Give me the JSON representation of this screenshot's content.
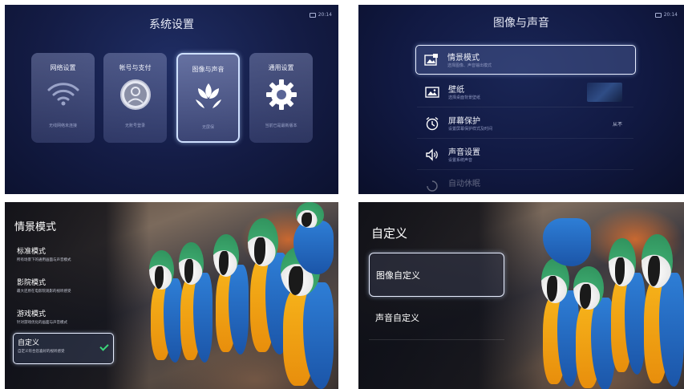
{
  "panel1": {
    "title": "系统设置",
    "clock": "20:14",
    "cards": [
      {
        "label": "网络设置",
        "sub": "无线网络未连接",
        "icon": "wifi-icon"
      },
      {
        "label": "帐号与支付",
        "sub": "无账号登录",
        "icon": "user-icon"
      },
      {
        "label": "图像与声音",
        "sub": "无屏保",
        "icon": "flower-icon"
      },
      {
        "label": "通用设置",
        "sub": "当前已是最新版本",
        "icon": "gear-icon"
      }
    ]
  },
  "panel2": {
    "title": "图像与声音",
    "clock": "20:14",
    "rows": [
      {
        "title": "情景模式",
        "sub": "选择图像、声音输出模式",
        "value": "",
        "icon": "scene-mode-icon"
      },
      {
        "title": "壁纸",
        "sub": "选择桌面背景壁纸",
        "value": "",
        "icon": "wallpaper-icon"
      },
      {
        "title": "屏幕保护",
        "sub": "设置屏幕保护样式及时间",
        "value": "从不",
        "icon": "alarm-clock-icon"
      },
      {
        "title": "声音设置",
        "sub": "设置系统声音",
        "value": "",
        "icon": "speaker-icon"
      },
      {
        "title": "自动休眠",
        "sub": "",
        "value": "",
        "icon": "sleep-icon"
      }
    ]
  },
  "panel3": {
    "heading": "情景模式",
    "modes": [
      {
        "title": "标准模式",
        "sub": "所有场景下的通用画面与声音模式"
      },
      {
        "title": "影院模式",
        "sub": "最大还原在电影院观影的视听感受"
      },
      {
        "title": "游戏模式",
        "sub": "针对游戏优化的画面与声音模式"
      },
      {
        "title": "自定义",
        "sub": "自定义符合您喜好的视听感受",
        "selected": true
      }
    ]
  },
  "panel4": {
    "heading": "自定义",
    "options": [
      {
        "label": "图像自定义"
      },
      {
        "label": "声音自定义"
      }
    ]
  },
  "colors": {
    "accent_focus": "#e8eeff",
    "check_green": "#3bd67a",
    "panel_bg": "#141c45"
  }
}
